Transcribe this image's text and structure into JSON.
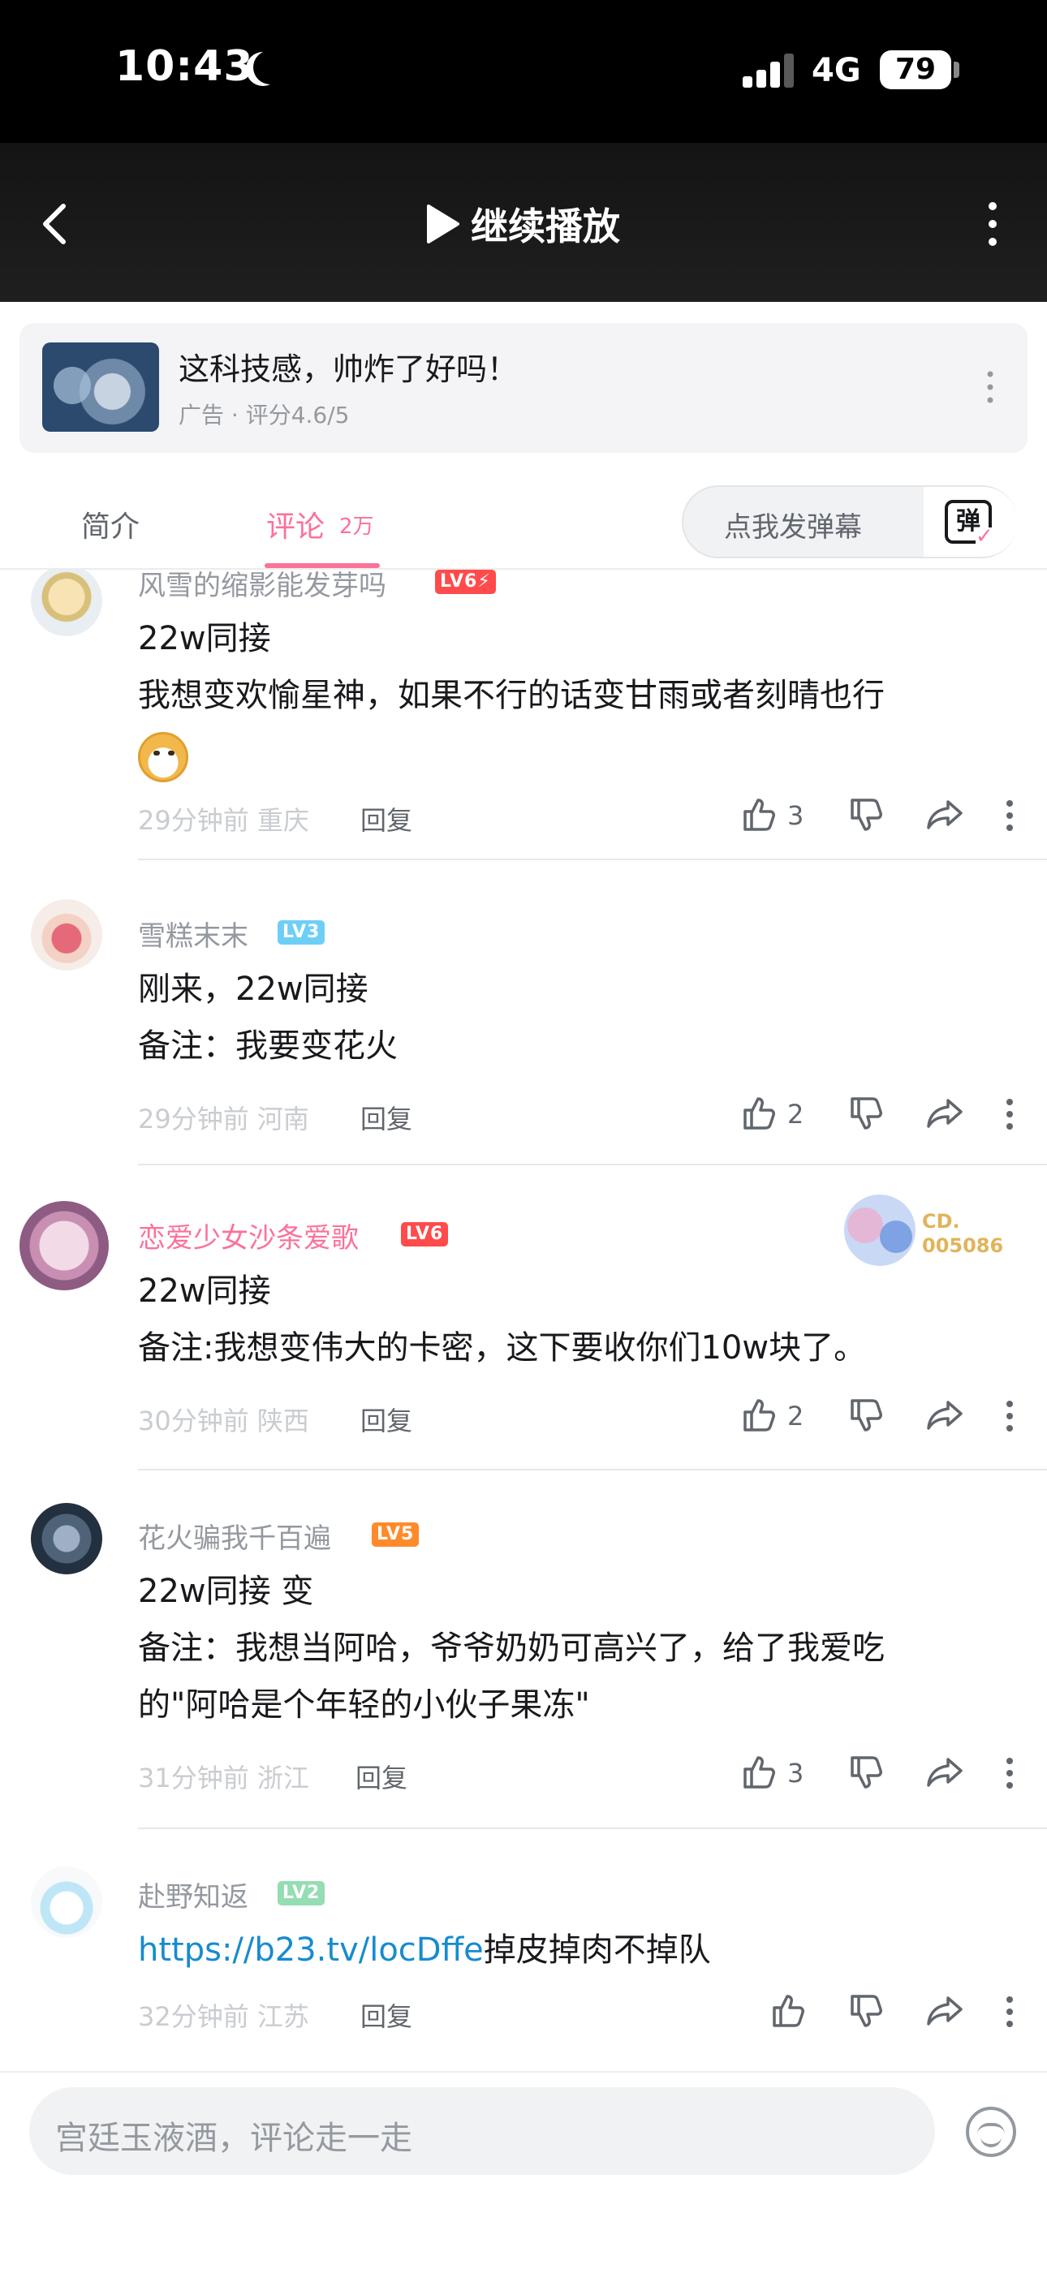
{
  "status_bar": {
    "time": "10:43",
    "network": "4G",
    "battery": "79"
  },
  "header": {
    "play_label": "继续播放"
  },
  "ad": {
    "title": "这科技感，帅炸了好吗！",
    "subtitle": "广告 · 评分4.6/5"
  },
  "tabs": {
    "intro": "简介",
    "comments": "评论",
    "comments_count": "2万",
    "danmaku_placeholder": "点我发弹幕",
    "danmaku_icon": "弹"
  },
  "comments": [
    {
      "username": "风雪的缩影能发芽吗",
      "level": "LV6⚡",
      "level_color": "#ff4b4b",
      "lines": [
        "22w同接",
        "我想变欢愉星神，如果不行的话变甘雨或者刻晴也行"
      ],
      "time": "29分钟前",
      "location": "重庆",
      "reply": "回复",
      "likes": "3"
    },
    {
      "username": "雪糕末末",
      "level": "LV3",
      "level_color": "#6ecff6",
      "lines": [
        "刚来，22w同接",
        "备注：我要变花火"
      ],
      "time": "29分钟前",
      "location": "河南",
      "reply": "回复",
      "likes": "2"
    },
    {
      "username": "恋爱少女沙条爱歌",
      "level": "LV6",
      "level_color": "#ff4b4b",
      "decor_text": "CD. 005086",
      "lines": [
        "22w同接",
        "备注:我想变伟大的卡密，这下要收你们10w块了。"
      ],
      "time": "30分钟前",
      "location": "陕西",
      "reply": "回复",
      "likes": "2"
    },
    {
      "username": "花火骗我千百遍",
      "level": "LV5",
      "level_color": "#ff8a2a",
      "lines": [
        "22w同接 变",
        "备注：我想当阿哈，爷爷奶奶可高兴了，给了我爱吃",
        "的\"阿哈是个年轻的小伙子果冻\""
      ],
      "time": "31分钟前",
      "location": "浙江",
      "reply": "回复",
      "likes": "3"
    },
    {
      "username": "赴野知返",
      "level": "LV2",
      "level_color": "#95ddb2",
      "link": "https://b23.tv/locDffe",
      "link_suffix": "掉皮掉肉不掉队",
      "time": "32分钟前",
      "location": "江苏",
      "reply": "回复",
      "likes": ""
    }
  ],
  "input": {
    "placeholder": "宫廷玉液酒，评论走一走"
  },
  "colors": {
    "accent": "#fb7299",
    "link": "#178bcf"
  }
}
